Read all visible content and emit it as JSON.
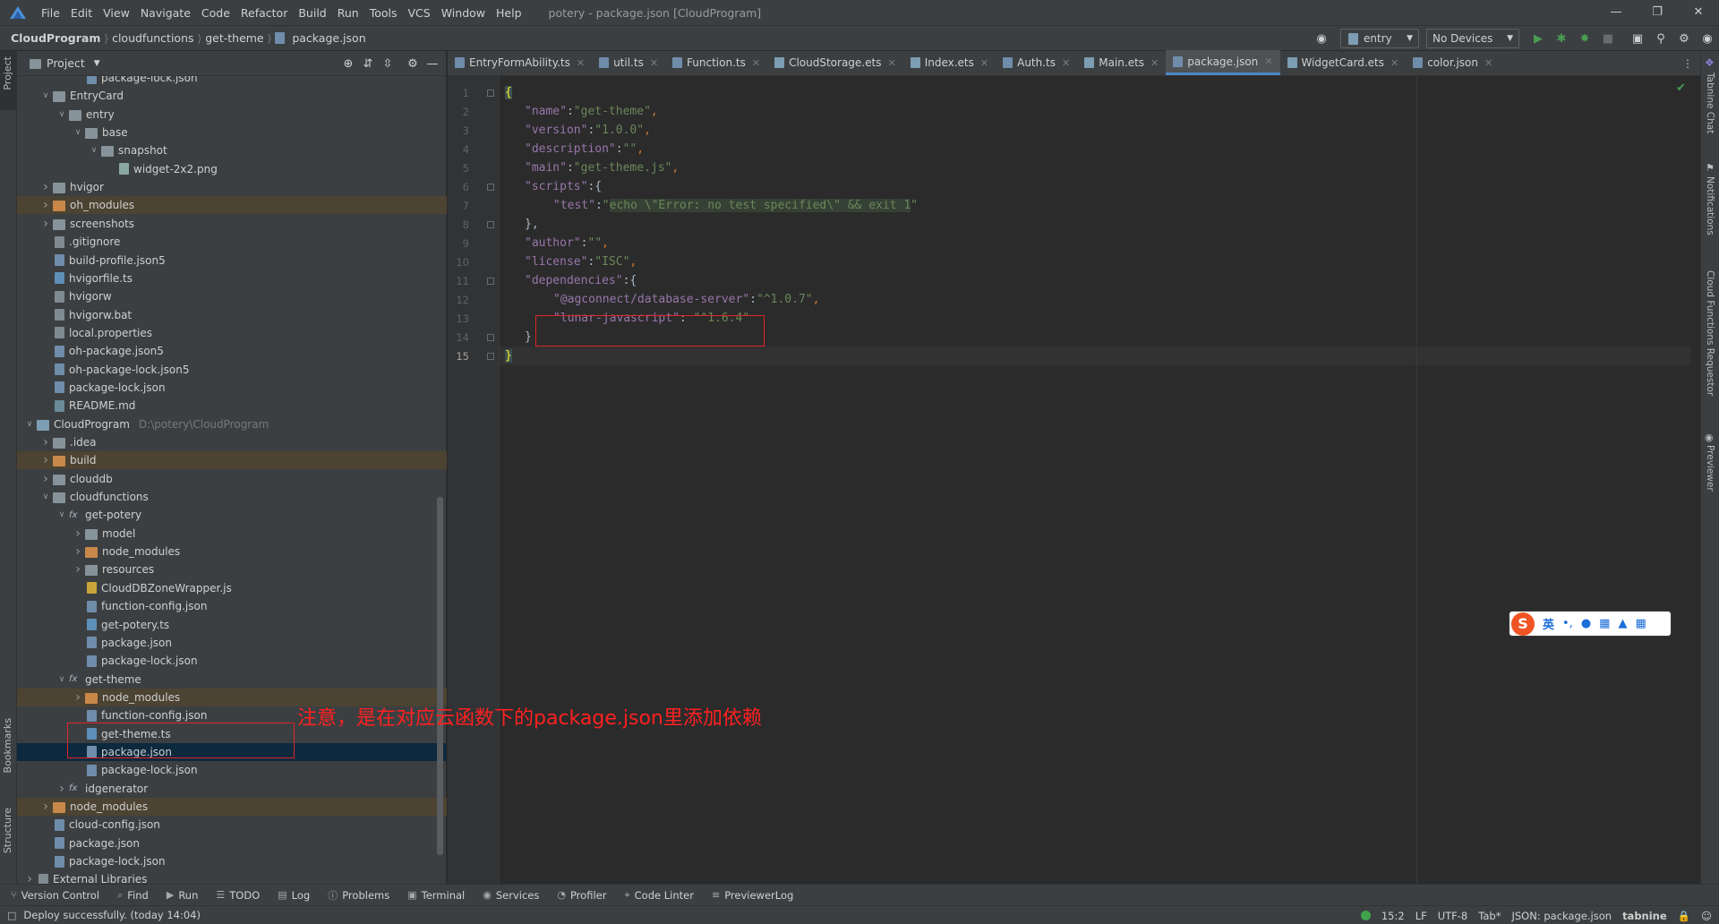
{
  "menubar": {
    "items": [
      "File",
      "Edit",
      "View",
      "Navigate",
      "Code",
      "Refactor",
      "Build",
      "Run",
      "Tools",
      "VCS",
      "Window",
      "Help"
    ],
    "window_title": "potery - package.json [CloudProgram]"
  },
  "navbar": {
    "breadcrumbs": [
      "CloudProgram",
      "cloudfunctions",
      "get-theme",
      "package.json"
    ],
    "run_config": "entry",
    "device": "No Devices"
  },
  "left_strip": {
    "project_label": "Project",
    "bookmarks_label": "Bookmarks",
    "structure_label": "Structure"
  },
  "right_strip": {
    "tabnine_label": "Tabnine Chat",
    "notifications_label": "Notifications",
    "cloud_label": "Cloud Functions Requestor",
    "previewer_label": "Previewer"
  },
  "project_panel": {
    "title": "Project",
    "tree": [
      {
        "label": "package-lock.json",
        "icon": "json-file-icon"
      },
      {
        "label": "EntryCard",
        "icon": "folder-icon",
        "arrow": "down"
      },
      {
        "label": "entry",
        "icon": "folder-icon",
        "arrow": "down"
      },
      {
        "label": "base",
        "icon": "folder-icon",
        "arrow": "down"
      },
      {
        "label": "snapshot",
        "icon": "folder-icon",
        "arrow": "down"
      },
      {
        "label": "widget-2x2.png",
        "icon": "image-file-icon"
      },
      {
        "label": "hvigor",
        "icon": "folder-icon",
        "arrow": "right"
      },
      {
        "label": "oh_modules",
        "icon": "folder-orange-icon",
        "arrow": "right"
      },
      {
        "label": "screenshots",
        "icon": "folder-icon",
        "arrow": "right"
      },
      {
        "label": ".gitignore",
        "icon": "file-icon"
      },
      {
        "label": "build-profile.json5",
        "icon": "json-file-icon"
      },
      {
        "label": "hvigorfile.ts",
        "icon": "ts-file-icon"
      },
      {
        "label": "hvigorw",
        "icon": "file-icon"
      },
      {
        "label": "hvigorw.bat",
        "icon": "file-icon"
      },
      {
        "label": "local.properties",
        "icon": "file-icon"
      },
      {
        "label": "oh-package.json5",
        "icon": "json-file-icon"
      },
      {
        "label": "oh-package-lock.json5",
        "icon": "json-file-icon"
      },
      {
        "label": "package-lock.json",
        "icon": "json-file-icon"
      },
      {
        "label": "README.md",
        "icon": "md-file-icon"
      },
      {
        "label": "CloudProgram",
        "icon": "module-icon",
        "arrow": "down",
        "extra": "D:\\potery\\CloudProgram"
      },
      {
        "label": ".idea",
        "icon": "folder-icon",
        "arrow": "right"
      },
      {
        "label": "build",
        "icon": "folder-orange-icon",
        "arrow": "right"
      },
      {
        "label": "clouddb",
        "icon": "folder-icon",
        "arrow": "right"
      },
      {
        "label": "cloudfunctions",
        "icon": "folder-icon",
        "arrow": "down"
      },
      {
        "label": "get-potery",
        "icon": "fx-icon",
        "arrow": "down"
      },
      {
        "label": "model",
        "icon": "folder-icon",
        "arrow": "right"
      },
      {
        "label": "node_modules",
        "icon": "folder-orange-icon",
        "arrow": "right"
      },
      {
        "label": "resources",
        "icon": "folder-icon",
        "arrow": "right"
      },
      {
        "label": "CloudDBZoneWrapper.js",
        "icon": "js-file-icon"
      },
      {
        "label": "function-config.json",
        "icon": "json-file-icon"
      },
      {
        "label": "get-potery.ts",
        "icon": "ts-file-icon"
      },
      {
        "label": "package.json",
        "icon": "json-file-icon"
      },
      {
        "label": "package-lock.json",
        "icon": "json-file-icon"
      },
      {
        "label": "get-theme",
        "icon": "fx-icon",
        "arrow": "down"
      },
      {
        "label": "node_modules",
        "icon": "folder-orange-icon",
        "arrow": "right"
      },
      {
        "label": "function-config.json",
        "icon": "json-file-icon"
      },
      {
        "label": "get-theme.ts",
        "icon": "ts-file-icon"
      },
      {
        "label": "package.json",
        "icon": "json-file-icon"
      },
      {
        "label": "package-lock.json",
        "icon": "json-file-icon"
      },
      {
        "label": "idgenerator",
        "icon": "fx-icon",
        "arrow": "right"
      },
      {
        "label": "node_modules",
        "icon": "folder-orange-icon",
        "arrow": "right"
      },
      {
        "label": "cloud-config.json",
        "icon": "json-file-icon"
      },
      {
        "label": "package.json",
        "icon": "json-file-icon"
      },
      {
        "label": "package-lock.json",
        "icon": "json-file-icon"
      },
      {
        "label": "External Libraries",
        "icon": "library-icon",
        "arrow": "right"
      }
    ]
  },
  "editor": {
    "tabs": [
      {
        "label": "EntryFormAbility.ts"
      },
      {
        "label": "util.ts"
      },
      {
        "label": "Function.ts"
      },
      {
        "label": "CloudStorage.ets"
      },
      {
        "label": "Index.ets"
      },
      {
        "label": "Auth.ts"
      },
      {
        "label": "Main.ets"
      },
      {
        "label": "package.json",
        "active": true
      },
      {
        "label": "WidgetCard.ets"
      },
      {
        "label": "color.json"
      }
    ],
    "line_numbers": [
      "1",
      "2",
      "3",
      "4",
      "5",
      "6",
      "7",
      "8",
      "9",
      "10",
      "11",
      "12",
      "13",
      "14",
      "15"
    ],
    "code": {
      "l1": "{",
      "l2_key": "\"name\"",
      "l2_val": "\"get-theme\"",
      "l3_key": "\"version\"",
      "l3_val": "\"1.0.0\"",
      "l4_key": "\"description\"",
      "l4_val": "\"\"",
      "l5_key": "\"main\"",
      "l5_val": "\"get-theme.js\"",
      "l6_key": "\"scripts\"",
      "l7_key": "\"test\"",
      "l7_val_open": "\"",
      "l7_val": "echo \\\"Error: no test specified\\\" && exit 1",
      "l7_val_close": "\"",
      "l8": "},",
      "l9_key": "\"author\"",
      "l9_val": "\"\"",
      "l10_key": "\"license\"",
      "l10_val": "\"ISC\"",
      "l11_key": "\"dependencies\"",
      "l12_key": "\"@agconnect/database-server\"",
      "l12_val": "\"^1.0.7\"",
      "l13_key": "\"lunar-javascript\"",
      "l13_val": "\"^1.6.4\"",
      "l14": "}",
      "l15": "}"
    },
    "annotation": "注意，是在对应云函数下的package.json里添加依赖"
  },
  "ime": {
    "lang": "英"
  },
  "toolstrip": [
    {
      "label": "Version Control",
      "icon": "branch-icon"
    },
    {
      "label": "Find",
      "icon": "search-icon"
    },
    {
      "label": "Run",
      "icon": "run-icon"
    },
    {
      "label": "TODO",
      "icon": "list-icon"
    },
    {
      "label": "Log",
      "icon": "log-icon"
    },
    {
      "label": "Problems",
      "icon": "info-icon"
    },
    {
      "label": "Terminal",
      "icon": "terminal-icon"
    },
    {
      "label": "Services",
      "icon": "services-icon"
    },
    {
      "label": "Profiler",
      "icon": "profiler-icon"
    },
    {
      "label": "Code Linter",
      "icon": "linter-icon"
    },
    {
      "label": "PreviewerLog",
      "icon": "doc-icon"
    }
  ],
  "statusbar": {
    "message": "Deploy successfully. (today 14:04)",
    "position": "15:2",
    "line_sep": "LF",
    "encoding": "UTF-8",
    "indent": "Tab*",
    "schema": "JSON: package.json",
    "plugin": "tabnine"
  },
  "colors": {
    "accent": "#4a88c7",
    "annotation": "#ff2020",
    "selected_row": "#0d293e",
    "ignored_row": "#4c4332"
  }
}
